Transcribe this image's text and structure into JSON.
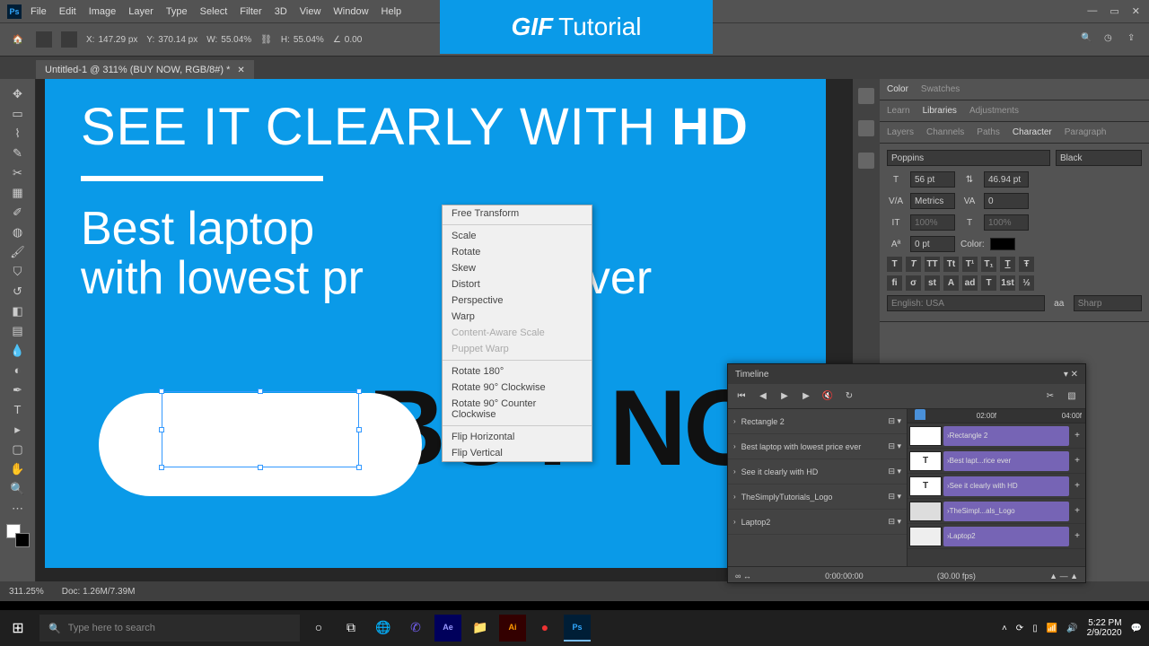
{
  "menu": {
    "items": [
      "File",
      "Edit",
      "Image",
      "Layer",
      "Type",
      "Select",
      "Filter",
      "3D",
      "View",
      "Window",
      "Help"
    ]
  },
  "options": {
    "x": "147.29 px",
    "y": "370.14 px",
    "w": "55.04%",
    "h": "55.04%",
    "angle": "0.00"
  },
  "tab": {
    "title": "Untitled-1 @ 311% (BUY NOW, RGB/8#) *"
  },
  "canvas": {
    "headline_a": "SEE IT CLEARLY WITH ",
    "headline_b": "HD",
    "sub_a": "Best laptop",
    "sub_b": "with lowest pr",
    "sub_c": "ever",
    "buynow": "BUY NO"
  },
  "ctx": {
    "a": "Free Transform",
    "items": [
      "Scale",
      "Rotate",
      "Skew",
      "Distort",
      "Perspective",
      "Warp",
      "Content-Aware Scale",
      "Puppet Warp"
    ],
    "rot": [
      "Rotate 180°",
      "Rotate 90° Clockwise",
      "Rotate 90° Counter Clockwise"
    ],
    "flip": [
      "Flip Horizontal",
      "Flip Vertical"
    ]
  },
  "right": {
    "row1": [
      "Color",
      "Swatches"
    ],
    "row2": [
      "Learn",
      "Libraries",
      "Adjustments"
    ],
    "row3": [
      "Layers",
      "Channels",
      "Paths",
      "Character",
      "Paragraph"
    ],
    "font": "Poppins",
    "weight": "Black",
    "size": "56 pt",
    "leading": "46.94 pt",
    "kern": "Metrics",
    "track": "0",
    "vscale": "100%",
    "hscale": "100%",
    "baseline": "0 pt",
    "colorlbl": "Color:",
    "lang": "English: USA",
    "aa": "Sharp"
  },
  "timeline": {
    "title": "Timeline",
    "marks": [
      "02:00f",
      "04:00f"
    ],
    "tracks": [
      "Rectangle 2",
      "Best laptop with lowest price ever",
      "See it clearly with HD",
      "TheSimplyTutorials_Logo",
      "Laptop2"
    ],
    "clips": [
      "Rectangle 2",
      "Best lapt...rice ever",
      "See it clearly with HD",
      "TheSimpl...als_Logo",
      "Laptop2"
    ],
    "time": "0:00:00:00",
    "fps": "(30.00 fps)"
  },
  "status": {
    "zoom": "311.25%",
    "doc": "Doc: 1.26M/7.39M"
  },
  "banner": {
    "a": "GIF",
    "b": " Tutorial"
  },
  "taskbar": {
    "search": "Type here to search",
    "time": "5:22 PM",
    "date": "2/9/2020"
  }
}
